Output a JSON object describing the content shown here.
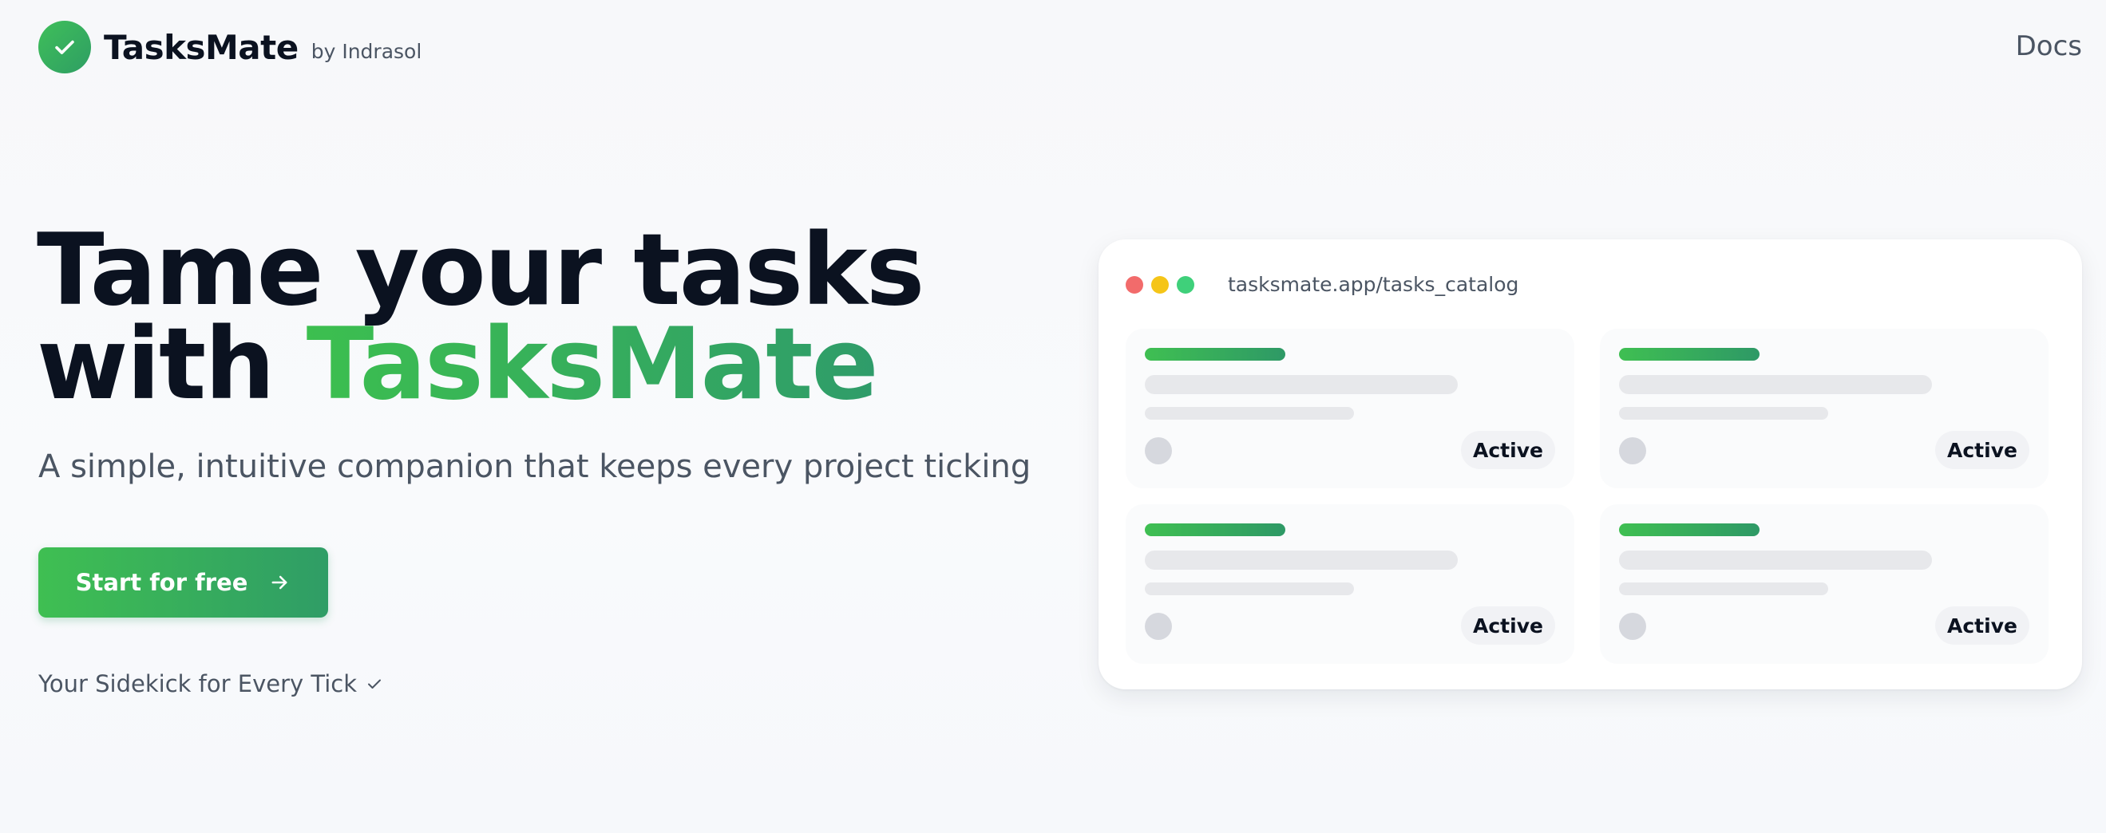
{
  "header": {
    "brand_name": "TasksMate",
    "brand_byline": "by Indrasol",
    "logo_icon": "check-icon",
    "docs_label": "Docs"
  },
  "hero": {
    "title_line1": "Tame your tasks",
    "title_line2_prefix": "with ",
    "title_line2_accent": "TasksMate",
    "subtitle": "A simple, intuitive companion that keeps every project ticking",
    "cta_label": "Start for free",
    "cta_icon": "arrow-right-icon",
    "tagline": "Your Sidekick for Every Tick",
    "tagline_icon": "check-icon"
  },
  "preview": {
    "window_dots": [
      "#f26b6b",
      "#f5c518",
      "#3fd07a"
    ],
    "url": "tasksmate.app/tasks_catalog",
    "cards": [
      {
        "status": "Active"
      },
      {
        "status": "Active"
      },
      {
        "status": "Active"
      },
      {
        "status": "Active"
      }
    ]
  },
  "colors": {
    "accent_start": "#3fbf52",
    "accent_end": "#2f9d66",
    "text_dark": "#0b1220",
    "text_muted": "#4b5563"
  }
}
